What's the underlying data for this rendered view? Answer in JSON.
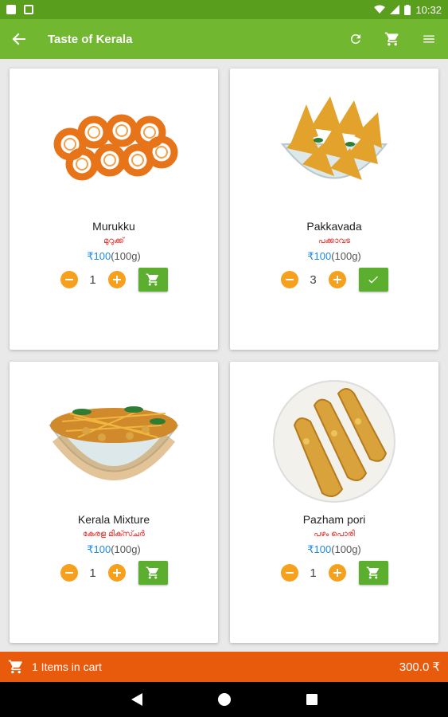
{
  "status_bar": {
    "time": "10:32"
  },
  "app_bar": {
    "title": "Taste of Kerala"
  },
  "products": [
    {
      "name": "Murukku",
      "name_ml": "മുറുക്ക്",
      "price": "₹100",
      "unit": "(100g)",
      "quantity": "1",
      "in_cart": false
    },
    {
      "name": "Pakkavada",
      "name_ml": "പക്കാവട",
      "price": "₹100",
      "unit": "(100g)",
      "quantity": "3",
      "in_cart": true
    },
    {
      "name": "Kerala Mixture",
      "name_ml": "കേരള മിക്സ്ചർ",
      "price": "₹100",
      "unit": "(100g)",
      "quantity": "1",
      "in_cart": false
    },
    {
      "name": "Pazham pori",
      "name_ml": "പഴം പൊരി",
      "price": "₹100",
      "unit": "(100g)",
      "quantity": "1",
      "in_cart": false
    }
  ],
  "cart_bar": {
    "items_text": "1 Items in cart",
    "total": "300.0 ₹"
  },
  "colors": {
    "app_bar": "#72b730",
    "status_bar": "#5a9e1e",
    "cart_bar": "#e85a0c",
    "stepper": "#f7a01d",
    "cart_button": "#5cae2e"
  },
  "icons": [
    "back-arrow-icon",
    "refresh-icon",
    "cart-icon",
    "menu-icon",
    "minus-icon",
    "plus-icon",
    "add-to-cart-icon",
    "check-icon",
    "nav-back-icon",
    "nav-home-icon",
    "nav-recents-icon"
  ]
}
